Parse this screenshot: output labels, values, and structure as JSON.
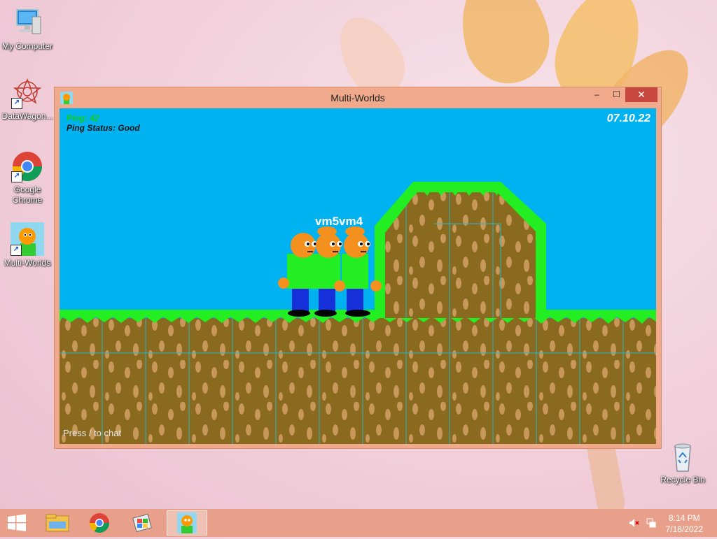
{
  "desktop": {
    "icons": [
      {
        "label": "My Computer",
        "icon": "computer-icon"
      },
      {
        "label": "DataWagon...",
        "icon": "datawagon-icon"
      },
      {
        "label": "Google Chrome",
        "icon": "chrome-icon"
      },
      {
        "label": "Multi-Worlds",
        "icon": "multi-worlds-icon"
      },
      {
        "label": "Recycle Bin",
        "icon": "recycle-bin-icon"
      }
    ]
  },
  "window": {
    "title": "Multi-Worlds",
    "controls": {
      "minimize": "–",
      "maximize": "☐",
      "close": "✕"
    }
  },
  "game": {
    "ping": "Ping: 42",
    "ping_status": "Ping Status: Good",
    "date": "07.10.22",
    "player_name": "vm5vm4",
    "chat_hint": "Press / to chat",
    "colors": {
      "sky": "#00b3f0",
      "grass": "#22ee22",
      "dirt": "#8a6a1e",
      "dirt_spot": "#c8975a"
    }
  },
  "taskbar": {
    "items": [
      {
        "name": "start-button",
        "icon": "windows-logo-icon"
      },
      {
        "name": "file-explorer",
        "icon": "folder-icon"
      },
      {
        "name": "chrome",
        "icon": "chrome-icon"
      },
      {
        "name": "app",
        "icon": "app-icon"
      },
      {
        "name": "multi-worlds",
        "icon": "multi-worlds-icon",
        "active": true
      }
    ],
    "time": "8:14 PM",
    "date": "7/18/2022"
  }
}
